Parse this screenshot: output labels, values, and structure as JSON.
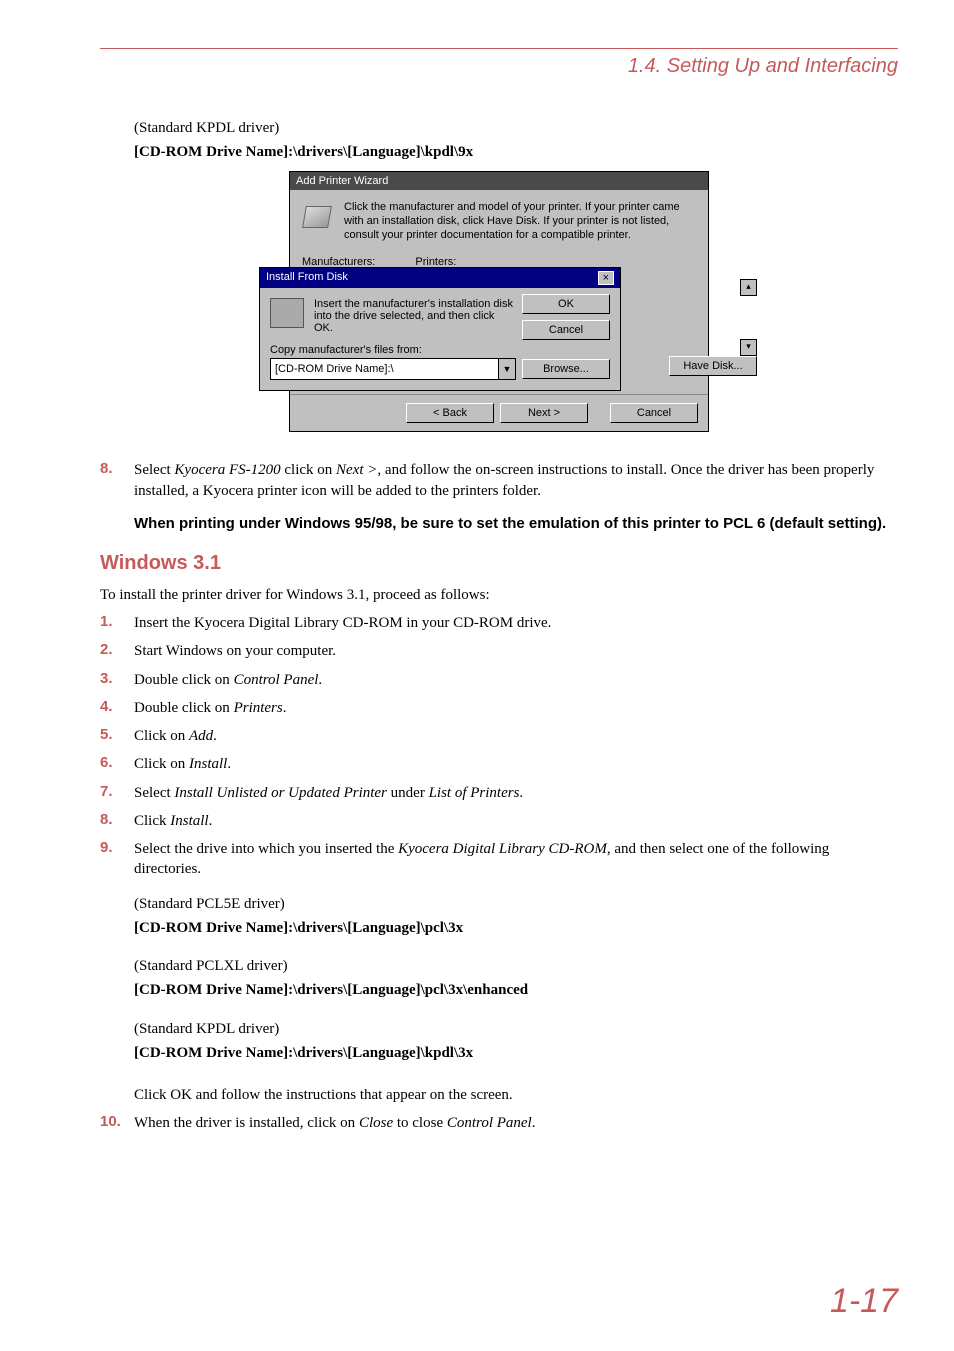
{
  "header": {
    "breadcrumb": "1.4.  Setting Up and Interfacing"
  },
  "intro": {
    "driver_note": "(Standard KPDL driver)",
    "driver_path": "[CD-ROM Drive Name]:\\drivers\\[Language]\\kpdl\\9x"
  },
  "wizard": {
    "title": "Add Printer Wizard",
    "desc": "Click the manufacturer and model of your printer. If your printer came with an installation disk, click Have Disk. If your printer is not listed, consult your printer documentation for a compatible printer.",
    "col_manufacturers": "Manufacturers:",
    "col_printers": "Printers:",
    "back": "< Back",
    "next": "Next >",
    "cancel": "Cancel",
    "have_disk": "Have Disk..."
  },
  "ifd": {
    "title": "Install From Disk",
    "close_x": "×",
    "instr": "Insert the manufacturer's installation disk into the drive selected, and then click OK.",
    "ok": "OK",
    "cancel": "Cancel",
    "copy_label": "Copy manufacturer's files from:",
    "combo_value": "[CD-ROM Drive Name]:\\",
    "browse": "Browse..."
  },
  "step8": {
    "num": "8.",
    "text_a": "Select ",
    "em1": "Kyocera FS-1200",
    "text_b": " click on ",
    "em2": "Next >",
    "text_c": ", and follow the on-screen instructions to install. Once the driver has been properly installed, a Kyocera printer icon will be added to the printers folder."
  },
  "note": "When printing under Windows 95/98, be sure to set the emulation of this printer to PCL 6 (default setting).",
  "section_title": "Windows 3.1",
  "lead": "To install the printer driver for Windows 3.1, proceed as follows:",
  "steps": {
    "s1": {
      "n": "1.",
      "t": "Insert the Kyocera Digital Library CD-ROM in your CD-ROM drive."
    },
    "s2": {
      "n": "2.",
      "t": "Start Windows on your computer."
    },
    "s3": {
      "n": "3.",
      "a": "Double click on ",
      "em": "Control Panel",
      "b": "."
    },
    "s4": {
      "n": "4.",
      "a": "Double click on ",
      "em": "Printers",
      "b": "."
    },
    "s5": {
      "n": "5.",
      "a": "Click on ",
      "em": "Add",
      "b": "."
    },
    "s6": {
      "n": "6.",
      "a": "Click on ",
      "em": "Install",
      "b": "."
    },
    "s7": {
      "n": "7.",
      "a": "Select ",
      "em": "Install Unlisted or Updated Printer",
      "b": " under ",
      "em2": "List of Printers",
      "c": "."
    },
    "s8": {
      "n": "8.",
      "a": "Click ",
      "em": "Install",
      "b": "."
    },
    "s9": {
      "n": "9.",
      "a": "Select the drive into which you inserted the ",
      "em": "Kyocera Digital Library CD-ROM",
      "b": ", and then select one of the following directories."
    },
    "s9_paths": {
      "p1_note": "(Standard PCL5E driver)",
      "p1_path": "[CD-ROM Drive Name]:\\drivers\\[Language]\\pcl\\3x",
      "p2_note": "(Standard PCLXL driver)",
      "p2_path": "[CD-ROM Drive Name]:\\drivers\\[Language]\\pcl\\3x\\enhanced",
      "p3_note": "(Standard KPDL driver)",
      "p3_path": "[CD-ROM Drive Name]:\\drivers\\[Language]\\kpdl\\3x"
    },
    "s9_tail": {
      "a": "Click ",
      "em": "OK",
      "b": " and follow the instructions that appear on the screen."
    },
    "s10": {
      "n": "10.",
      "a": "When the driver is installed, click on ",
      "em": "Close",
      "b": " to close ",
      "em2": "Control Panel",
      "c": "."
    }
  },
  "page_number": "1-17"
}
